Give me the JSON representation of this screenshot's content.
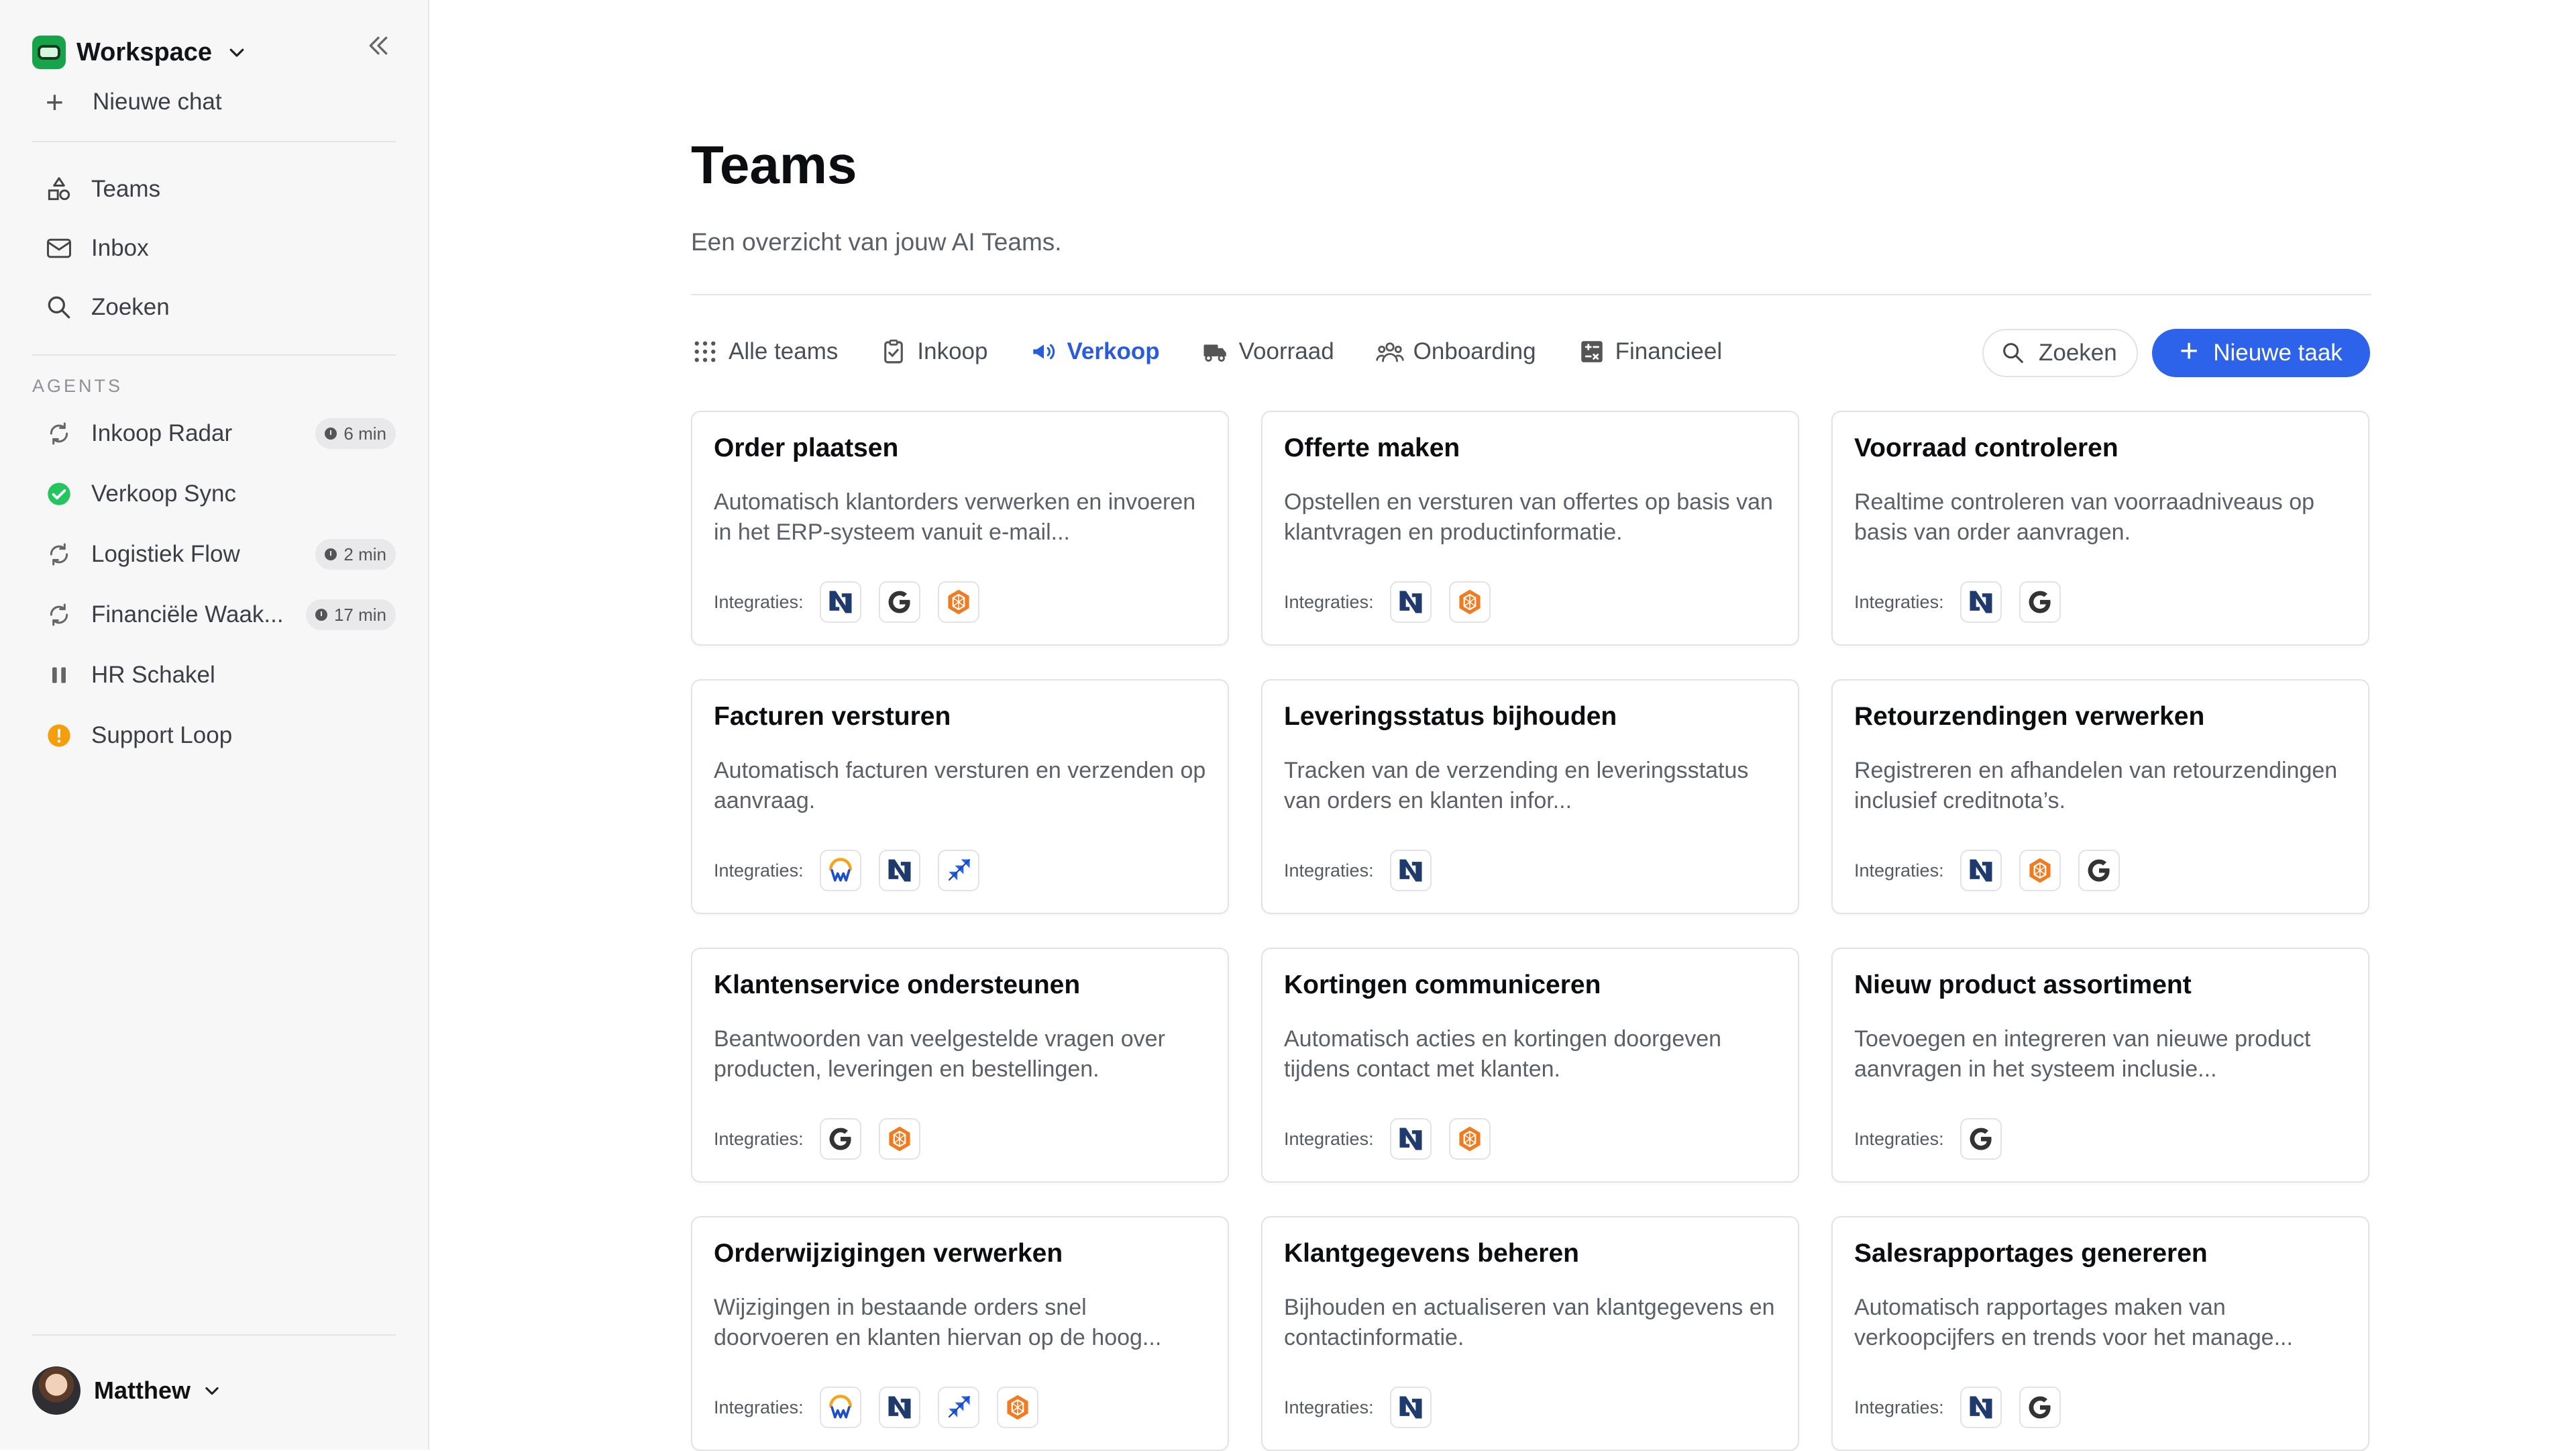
{
  "sidebar": {
    "workspace_name": "Workspace",
    "new_chat_label": "Nieuwe chat",
    "nav": [
      {
        "label": "Teams",
        "icon": "shapes-icon"
      },
      {
        "label": "Inbox",
        "icon": "mail-icon"
      },
      {
        "label": "Zoeken",
        "icon": "search-icon"
      }
    ],
    "agents_heading": "AGENTS",
    "agents": [
      {
        "name": "Inkoop Radar",
        "status": "running",
        "badge": "6 min"
      },
      {
        "name": "Verkoop Sync",
        "status": "success",
        "badge": ""
      },
      {
        "name": "Logistiek Flow",
        "status": "running",
        "badge": "2 min"
      },
      {
        "name": "Financiële Waak...",
        "status": "running",
        "badge": "17 min"
      },
      {
        "name": "HR Schakel",
        "status": "paused",
        "badge": ""
      },
      {
        "name": "Support Loop",
        "status": "warning",
        "badge": ""
      }
    ],
    "user_name": "Matthew"
  },
  "main": {
    "title": "Teams",
    "subtitle": "Een overzicht van jouw AI Teams.",
    "tabs": [
      {
        "label": "Alle teams",
        "icon": "grid-icon"
      },
      {
        "label": "Inkoop",
        "icon": "clipboard-icon"
      },
      {
        "label": "Verkoop",
        "icon": "megaphone-icon",
        "active": true
      },
      {
        "label": "Voorraad",
        "icon": "truck-icon"
      },
      {
        "label": "Onboarding",
        "icon": "users-icon"
      },
      {
        "label": "Financieel",
        "icon": "calculator-icon"
      }
    ],
    "search_label": "Zoeken",
    "new_task_label": "Nieuwe taak",
    "integrations_label": "Integraties:",
    "cards": [
      {
        "title": "Order plaatsen",
        "desc": "Automatisch klantorders verwerken en invoeren in het ERP-systeem vanuit e-mail...",
        "integrations": [
          "netsuite",
          "google",
          "magento"
        ]
      },
      {
        "title": "Offerte maken",
        "desc": "Opstellen en versturen van offertes op basis van klantvragen en productinformatie.",
        "integrations": [
          "netsuite",
          "magento"
        ]
      },
      {
        "title": "Voorraad controleren",
        "desc": "Realtime controleren van voorraadniveaus op basis van order aanvragen.",
        "integrations": [
          "netsuite",
          "google"
        ]
      },
      {
        "title": "Facturen versturen",
        "desc": "Automatisch facturen versturen en verzenden op aanvraag.",
        "integrations": [
          "wave",
          "netsuite",
          "jira"
        ]
      },
      {
        "title": "Leveringsstatus bijhouden",
        "desc": "Tracken van de verzending en leveringsstatus van orders en klanten infor...",
        "integrations": [
          "netsuite"
        ]
      },
      {
        "title": "Retourzendingen verwerken",
        "desc": "Registreren en afhandelen van retourzendingen inclusief creditnota’s.",
        "integrations": [
          "netsuite",
          "magento",
          "google"
        ]
      },
      {
        "title": "Klantenservice ondersteunen",
        "desc": "Beantwoorden van veelgestelde vragen over producten, leveringen en bestellingen.",
        "integrations": [
          "google",
          "magento"
        ]
      },
      {
        "title": "Kortingen communiceren",
        "desc": "Automatisch acties en kortingen doorgeven tijdens contact met klanten.",
        "integrations": [
          "netsuite",
          "magento"
        ]
      },
      {
        "title": "Nieuw product assortiment",
        "desc": "Toevoegen en integreren van nieuwe product aanvragen in het systeem inclusie...",
        "integrations": [
          "google"
        ]
      },
      {
        "title": "Orderwijzigingen verwerken",
        "desc": "Wijzigingen in bestaande orders snel doorvoeren en klanten hiervan op de hoog...",
        "integrations": [
          "wave",
          "netsuite",
          "jira",
          "magento"
        ]
      },
      {
        "title": "Klantgegevens beheren",
        "desc": "Bijhouden en actualiseren van klantgegevens en contactinformatie.",
        "integrations": [
          "netsuite"
        ]
      },
      {
        "title": "Salesrapportages genereren",
        "desc": "Automatisch rapportages maken van verkoopcijfers en trends voor het manage...",
        "integrations": [
          "netsuite",
          "google"
        ]
      }
    ]
  },
  "colors": {
    "accent": "#2d63ea",
    "active_tab": "#2a5bdc",
    "success": "#22c55e",
    "warning": "#f59e0b",
    "workspace_logo": "#16a34a"
  }
}
